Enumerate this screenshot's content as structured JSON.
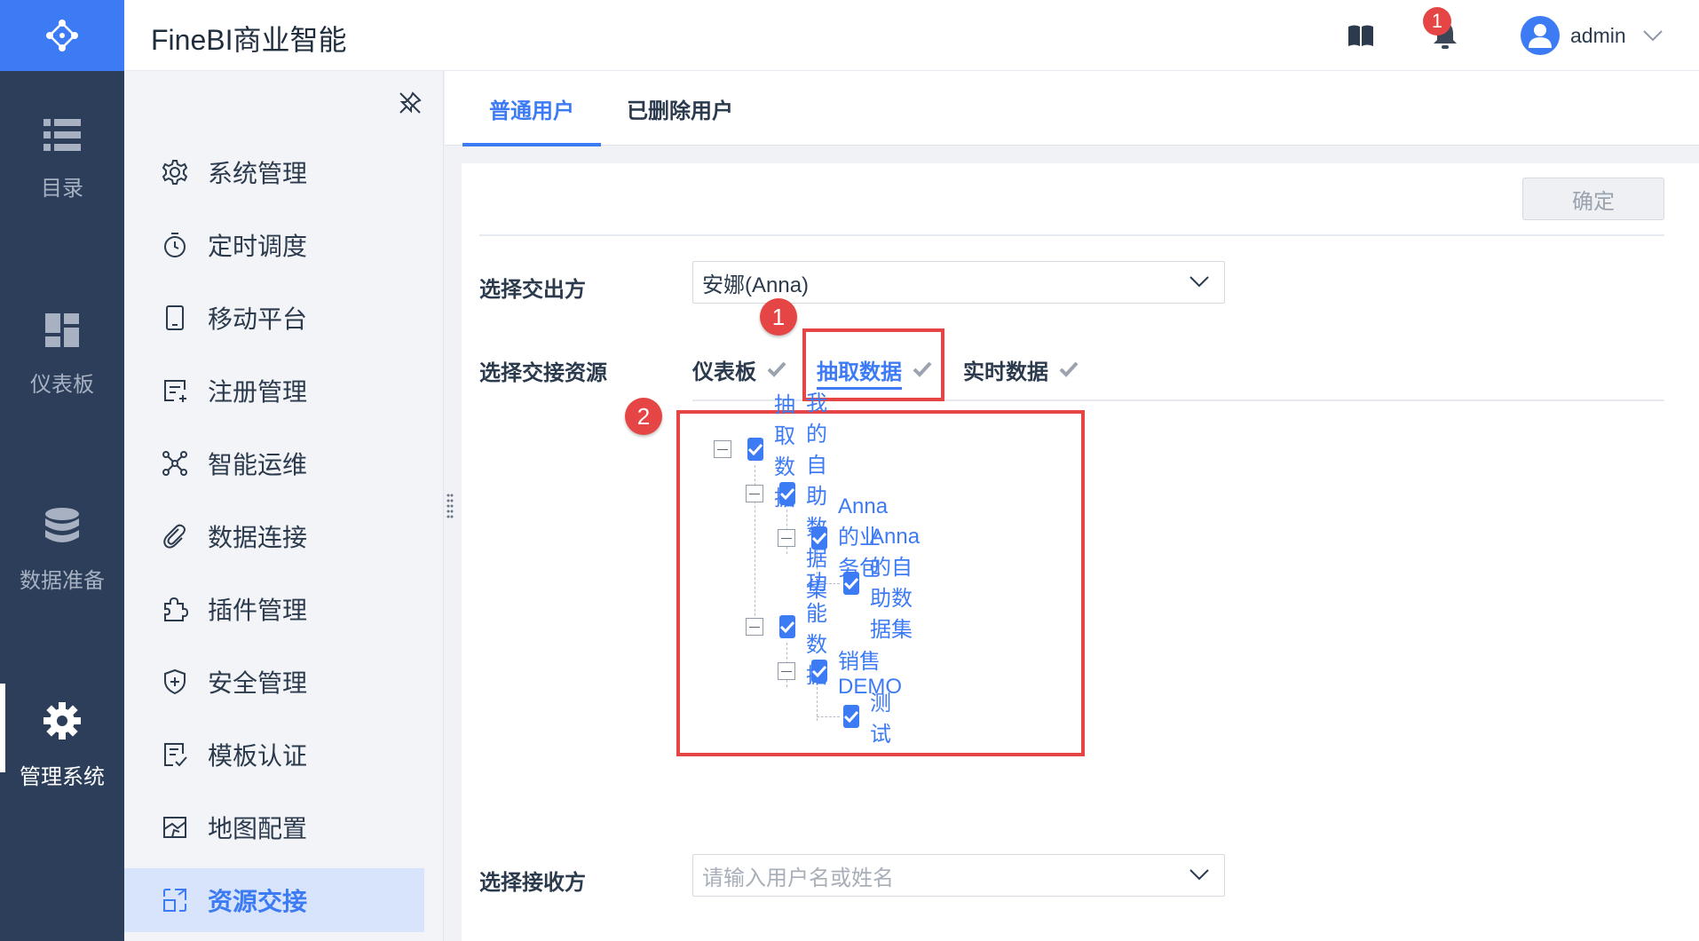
{
  "app": {
    "title": "FineBI商业智能"
  },
  "user": {
    "name": "admin"
  },
  "notifications": {
    "count": "1"
  },
  "leftnav": [
    {
      "label": "目录",
      "icon": "list-icon"
    },
    {
      "label": "仪表板",
      "icon": "dashboard-icon"
    },
    {
      "label": "数据准备",
      "icon": "database-icon"
    },
    {
      "label": "管理系统",
      "icon": "gear-icon",
      "active": true
    }
  ],
  "sidebar": {
    "items": [
      {
        "label": "系统管理",
        "icon": "gear-outline-icon"
      },
      {
        "label": "定时调度",
        "icon": "timer-icon"
      },
      {
        "label": "移动平台",
        "icon": "tablet-icon"
      },
      {
        "label": "注册管理",
        "icon": "register-icon"
      },
      {
        "label": "智能运维",
        "icon": "network-icon"
      },
      {
        "label": "数据连接",
        "icon": "link-icon"
      },
      {
        "label": "插件管理",
        "icon": "puzzle-icon"
      },
      {
        "label": "安全管理",
        "icon": "shield-icon"
      },
      {
        "label": "模板认证",
        "icon": "template-icon"
      },
      {
        "label": "地图配置",
        "icon": "map-icon"
      },
      {
        "label": "资源交接",
        "icon": "handover-icon",
        "active": true
      }
    ]
  },
  "tabs": [
    {
      "label": "普通用户",
      "active": true
    },
    {
      "label": "已删除用户",
      "active": false
    }
  ],
  "form": {
    "confirm_label": "确定",
    "sender_label": "选择交出方",
    "sender_value": "安娜(Anna)",
    "resource_label": "选择交接资源",
    "resource_tabs": [
      {
        "label": "仪表板",
        "active": false
      },
      {
        "label": "抽取数据",
        "active": true
      },
      {
        "label": "实时数据",
        "active": false
      }
    ],
    "receiver_label": "选择接收方",
    "receiver_placeholder": "请输入用户名或姓名"
  },
  "tree": [
    {
      "label": "抽取数据",
      "level": 0,
      "checked": true
    },
    {
      "label": "我的自助数据集",
      "level": 1,
      "checked": true
    },
    {
      "label": "Anna的业务包",
      "level": 2,
      "checked": true
    },
    {
      "label": "Anna的自助数据集",
      "level": 3,
      "checked": true
    },
    {
      "label": "功能数据",
      "level": 1,
      "checked": true
    },
    {
      "label": "销售DEMO",
      "level": 2,
      "checked": true
    },
    {
      "label": "测试",
      "level": 3,
      "checked": true
    }
  ],
  "annotations": [
    {
      "label": "1"
    },
    {
      "label": "2"
    }
  ],
  "colors": {
    "accent": "#3d7bf5",
    "nav_bg": "#2c3e5a",
    "highlight": "#e64545"
  }
}
